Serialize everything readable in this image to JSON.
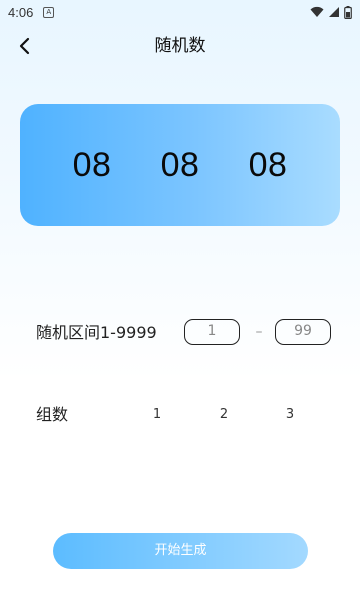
{
  "status_bar": {
    "time": "4:06",
    "app_icon": "A",
    "icons": [
      "wifi-icon",
      "signal-icon",
      "battery-icon"
    ]
  },
  "header": {
    "title": "随机数",
    "back_icon": "chevron-left-icon"
  },
  "numbers": [
    "08",
    "08",
    "08"
  ],
  "range": {
    "label": "随机区间1-9999",
    "min_value": "1",
    "separator": "–",
    "max_value": "99"
  },
  "groups": {
    "label": "组数",
    "options": [
      "1",
      "2",
      "3"
    ]
  },
  "action": {
    "start_label": "开始生成"
  },
  "colors": {
    "card_gradient_start": "#4fb2ff",
    "card_gradient_end": "#a9dcff",
    "button_gradient_start": "#5cbcff",
    "button_gradient_end": "#a3d9ff"
  }
}
